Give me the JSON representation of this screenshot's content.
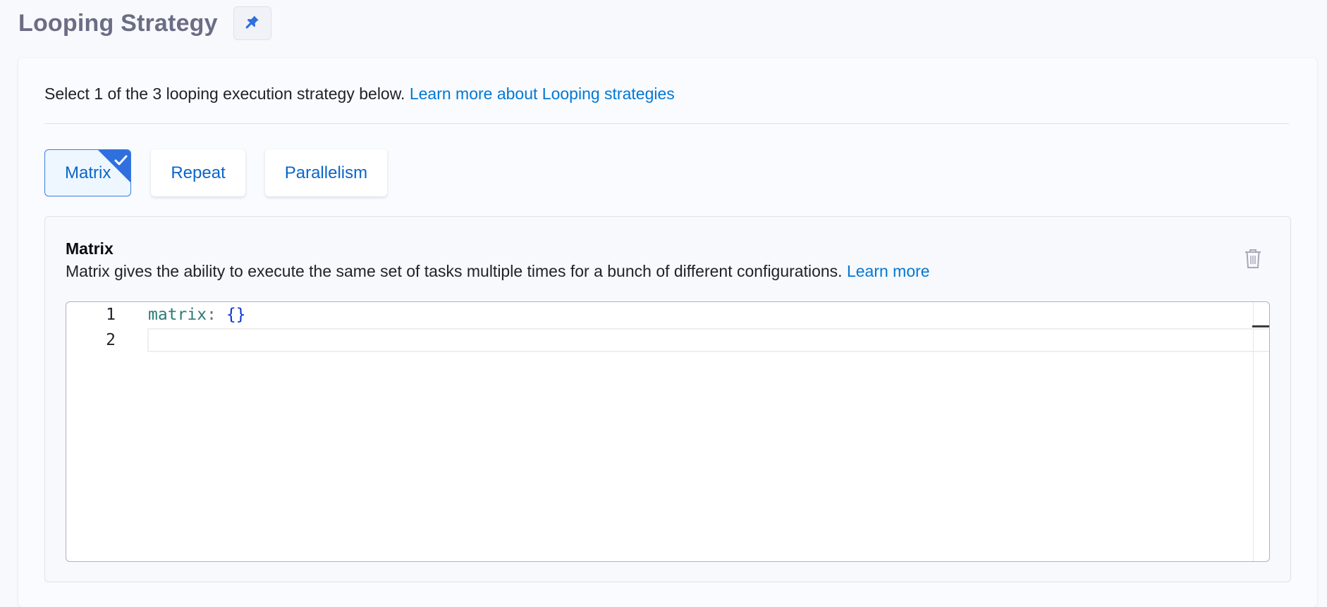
{
  "header": {
    "title": "Looping Strategy",
    "pin_icon": "pin-icon"
  },
  "description": {
    "text": "Select 1 of the 3 looping execution strategy below. ",
    "link": "Learn more about Looping strategies"
  },
  "tabs": [
    {
      "label": "Matrix",
      "selected": true
    },
    {
      "label": "Repeat",
      "selected": false
    },
    {
      "label": "Parallelism",
      "selected": false
    }
  ],
  "panel": {
    "title": "Matrix",
    "description": "Matrix gives the ability to execute the same set of tasks multiple times for a bunch of different configurations. ",
    "link": "Learn more",
    "delete_icon": "trash-icon"
  },
  "editor": {
    "line_numbers": [
      "1",
      "2"
    ],
    "line1": {
      "key": "matrix",
      "colon": ":",
      "value": "{}"
    }
  },
  "colors": {
    "accent": "#0278d5",
    "selected_border": "#3c7ee0",
    "title": "#6b6d85"
  }
}
